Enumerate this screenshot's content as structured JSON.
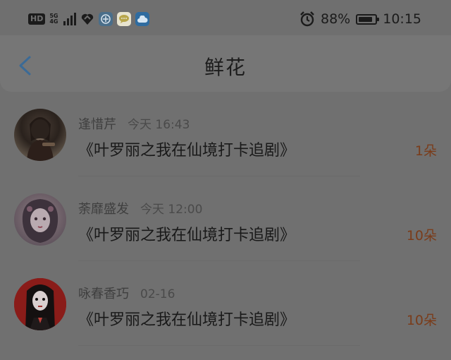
{
  "status_bar": {
    "hd": "HD",
    "network_top": "5G",
    "network_bottom": "4G",
    "battery_percent": "88%",
    "battery_level": 0.88,
    "time": "10:15",
    "icons": [
      "signal-icon",
      "heart-wifi-icon",
      "app-icon-1",
      "chat-app-icon",
      "cloud-icon",
      "alarm-icon",
      "battery-icon"
    ]
  },
  "header": {
    "title": "鲜花",
    "back_icon": "chevron-left-icon",
    "accent": "#3b6a96"
  },
  "list": [
    {
      "name": "逢惜芹",
      "time": "今天 16:43",
      "book": "《叶罗丽之我在仙境打卡追剧》",
      "count": "1朵"
    },
    {
      "name": "荼靡盛发",
      "time": "今天 12:00",
      "book": "《叶罗丽之我在仙境打卡追剧》",
      "count": "10朵"
    },
    {
      "name": "咏春香巧",
      "time": "02-16",
      "book": "《叶罗丽之我在仙境打卡追剧》",
      "count": "10朵"
    }
  ]
}
